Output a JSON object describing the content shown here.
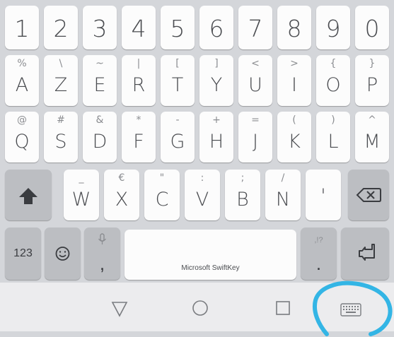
{
  "keyboard": {
    "number_row": [
      "1",
      "2",
      "3",
      "4",
      "5",
      "6",
      "7",
      "8",
      "9",
      "0"
    ],
    "row1": [
      {
        "main": "A",
        "sec": "%"
      },
      {
        "main": "Z",
        "sec": "\\"
      },
      {
        "main": "E",
        "sec": "~"
      },
      {
        "main": "R",
        "sec": "|"
      },
      {
        "main": "T",
        "sec": "["
      },
      {
        "main": "Y",
        "sec": "]"
      },
      {
        "main": "U",
        "sec": "<"
      },
      {
        "main": "I",
        "sec": ">"
      },
      {
        "main": "O",
        "sec": "{"
      },
      {
        "main": "P",
        "sec": "}"
      }
    ],
    "row2": [
      {
        "main": "Q",
        "sec": "@"
      },
      {
        "main": "S",
        "sec": "#"
      },
      {
        "main": "D",
        "sec": "&"
      },
      {
        "main": "F",
        "sec": "*"
      },
      {
        "main": "G",
        "sec": "-"
      },
      {
        "main": "H",
        "sec": "+"
      },
      {
        "main": "J",
        "sec": "="
      },
      {
        "main": "K",
        "sec": "("
      },
      {
        "main": "L",
        "sec": ")"
      },
      {
        "main": "M",
        "sec": "^"
      }
    ],
    "row3": [
      {
        "main": "W",
        "sec": "_"
      },
      {
        "main": "X",
        "sec": "€"
      },
      {
        "main": "C",
        "sec": "\""
      },
      {
        "main": "V",
        "sec": ":"
      },
      {
        "main": "B",
        "sec": ";"
      },
      {
        "main": "N",
        "sec": "/"
      },
      {
        "main": "'",
        "sec": ""
      }
    ],
    "shift_icon": "shift-arrow-icon",
    "backspace_icon": "backspace-icon",
    "bottom": {
      "numbers_label": "123",
      "emoji_icon": "smiley-icon",
      "comma_label": ",",
      "mic_icon": "microphone-icon",
      "space_label": "Microsoft SwiftKey",
      "period_label": ".",
      "period_sec": ",!?",
      "enter_icon": "enter-arrow-icon"
    }
  },
  "navbar": {
    "back_icon": "triangle-back-icon",
    "home_icon": "circle-home-icon",
    "recents_icon": "square-recents-icon",
    "keyboard_icon": "keyboard-switch-icon"
  },
  "annotation": {
    "color": "#33b5e5",
    "target": "keyboard-switch-icon"
  },
  "colors": {
    "keyboard_bg": "#d4d6da",
    "key_bg": "#fcfcfc",
    "key_gray": "#bcbec2",
    "navbar_bg": "#ececee"
  }
}
